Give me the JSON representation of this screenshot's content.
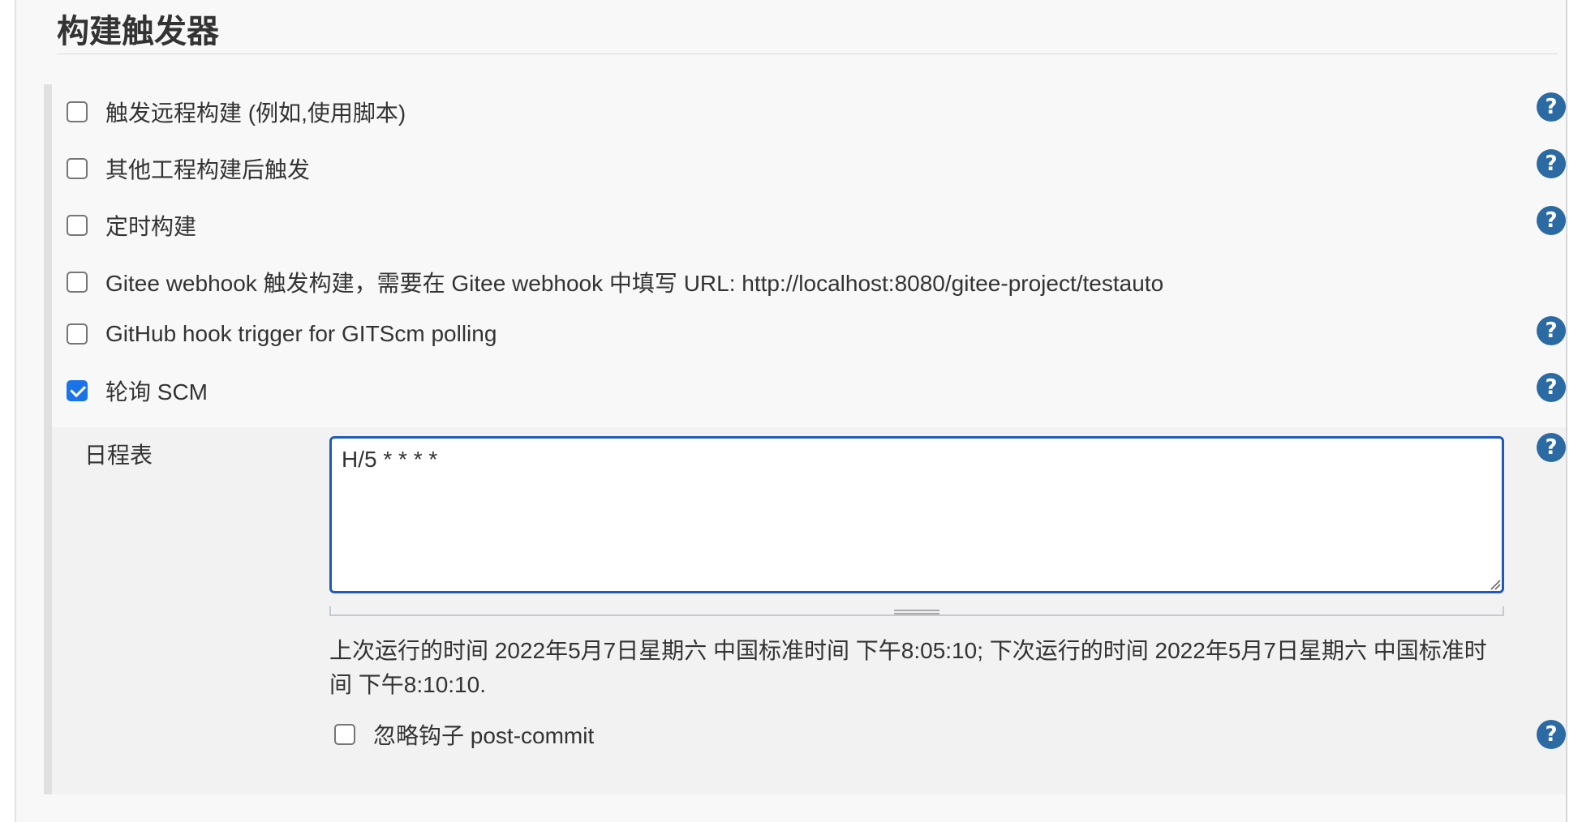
{
  "section": {
    "title": "构建触发器"
  },
  "triggers": [
    {
      "label": "触发远程构建 (例如,使用脚本)",
      "checked": false,
      "help_icon": "question-circle-icon"
    },
    {
      "label": "其他工程构建后触发",
      "checked": false,
      "help_icon": "question-circle-icon"
    },
    {
      "label": "定时构建",
      "checked": false,
      "help_icon": "question-circle-icon"
    },
    {
      "label": "Gitee webhook 触发构建，需要在 Gitee webhook 中填写 URL: http://localhost:8080/gitee-project/testauto",
      "checked": false
    },
    {
      "label": "GitHub hook trigger for GITScm polling",
      "checked": false,
      "help_icon": "question-circle-icon"
    },
    {
      "label": "轮询 SCM",
      "checked": true,
      "help_icon": "question-circle-icon"
    }
  ],
  "poll_scm": {
    "schedule_label": "日程表",
    "schedule_value": "H/5 * * * *",
    "schedule_info": "上次运行的时间 2022年5月7日星期六 中国标准时间 下午8:05:10; 下次运行的时间 2022年5月7日星期六 中国标准时间 下午8:10:10.",
    "ignore_post_commit_label": "忽略钩子 post-commit",
    "ignore_post_commit_checked": false
  },
  "help_symbol": "?",
  "colors": {
    "help_icon": "#2b6aa3",
    "checkbox_checked": "#1a73e8",
    "textarea_focus_border": "#1f5bb8",
    "panel_bg": "#f8f8f8",
    "sub_panel_bg": "#f2f2f2"
  }
}
